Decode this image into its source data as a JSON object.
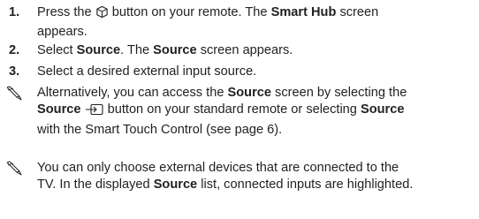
{
  "steps": [
    {
      "number": "1.",
      "before": "Press the ",
      "icon": "smart-hub-cube-icon",
      "middle": " button on your remote. The ",
      "bold": "Smart Hub",
      "after_line1": " screen",
      "after_line2": "appears."
    },
    {
      "number": "2.",
      "t1": "Select ",
      "b1": "Source",
      "t2": ". The ",
      "b2": "Source",
      "t3": " screen appears."
    },
    {
      "number": "3.",
      "text": "Select a desired external input source."
    }
  ],
  "notes": [
    {
      "icon": "note-pencil-icon",
      "l1a": "Alternatively, you can access the ",
      "l1b": "Source",
      "l1c": " screen by selecting the",
      "l2a": "Source",
      "l2icon": "source-input-icon",
      "l2b": " button on your standard remote or selecting ",
      "l2c": "Source",
      "l3": "with the Smart Touch Control (see page 6)."
    },
    {
      "icon": "note-pencil-icon",
      "l1": "You can only choose external devices that are connected to the",
      "l2a": "TV. In the displayed ",
      "l2b": "Source",
      "l2c": " list, connected inputs are highlighted."
    }
  ]
}
